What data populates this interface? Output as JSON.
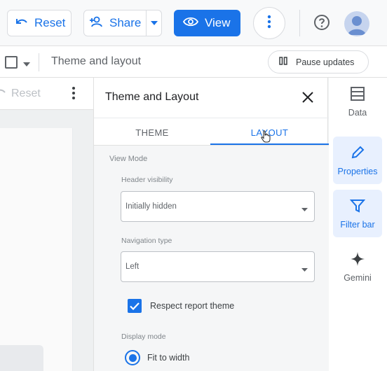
{
  "toolbar": {
    "reset_label": "Reset",
    "share_label": "Share",
    "view_label": "View"
  },
  "subbar": {
    "title": "Theme and layout",
    "pause_label": "Pause updates"
  },
  "canvas": {
    "reset_label": "Reset"
  },
  "panel": {
    "title": "Theme and Layout",
    "tabs": [
      {
        "label": "THEME",
        "active": false
      },
      {
        "label": "LAYOUT",
        "active": true
      }
    ],
    "view_mode_label": "View Mode",
    "header_visibility": {
      "label": "Header visibility",
      "value": "Initially hidden"
    },
    "navigation_type": {
      "label": "Navigation type",
      "value": "Left"
    },
    "respect_theme": {
      "label": "Respect report theme",
      "checked": true
    },
    "display_mode": {
      "label": "Display mode",
      "option": "Fit to width",
      "selected": true
    }
  },
  "rail": [
    {
      "label": "Data",
      "icon": "data-table-icon",
      "active": false
    },
    {
      "label": "Properties",
      "icon": "pencil-icon",
      "active": true
    },
    {
      "label": "Filter bar",
      "icon": "filter-icon",
      "active": true
    },
    {
      "label": "Gemini",
      "icon": "sparkle-icon",
      "active": false
    }
  ],
  "colors": {
    "accent": "#1a73e8",
    "active_bg": "#e8f0fe"
  }
}
